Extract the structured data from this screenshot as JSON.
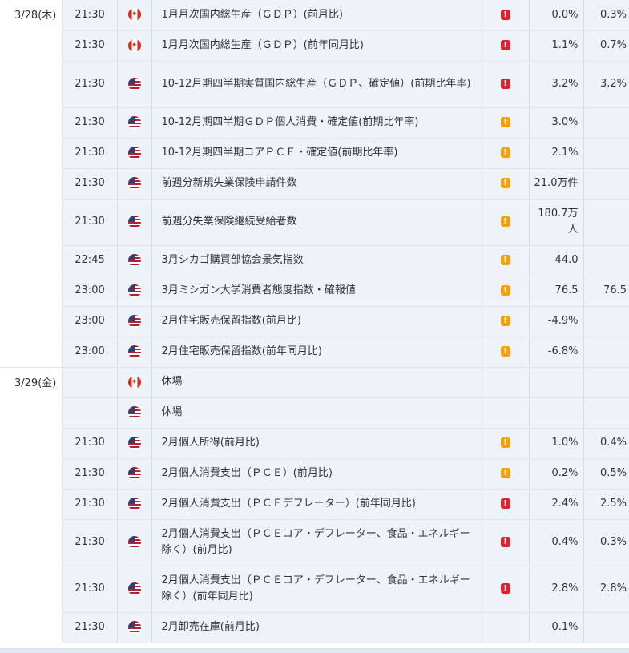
{
  "colors": {
    "high": "#d9232f",
    "mid": "#f5a00f",
    "row_bg": "#eef3fa"
  },
  "days": [
    {
      "date": "3/28(木)",
      "rows": [
        {
          "time": "21:30",
          "country": "ca",
          "flag_icon": "canada-flag-icon",
          "event": "1月月次国内総生産（ＧＤＰ）(前月比)",
          "importance": "high",
          "mark": "!",
          "previous": "0.0%",
          "forecast": "0.3%"
        },
        {
          "time": "21:30",
          "country": "ca",
          "flag_icon": "canada-flag-icon",
          "event": "1月月次国内総生産（ＧＤＰ）(前年同月比)",
          "importance": "high",
          "mark": "!",
          "previous": "1.1%",
          "forecast": "0.7%"
        },
        {
          "time": "21:30",
          "country": "us",
          "flag_icon": "us-flag-icon",
          "event": "10-12月期四半期実質国内総生産（ＧＤＰ、確定値）(前期比年率)",
          "importance": "high",
          "mark": "!",
          "previous": "3.2%",
          "forecast": "3.2%",
          "tall": true
        },
        {
          "time": "21:30",
          "country": "us",
          "flag_icon": "us-flag-icon",
          "event": "10-12月期四半期ＧＤＰ個人消費・確定値(前期比年率)",
          "importance": "mid",
          "mark": "!",
          "previous": "3.0%",
          "forecast": ""
        },
        {
          "time": "21:30",
          "country": "us",
          "flag_icon": "us-flag-icon",
          "event": "10-12月期四半期コアＰＣＥ・確定値(前期比年率)",
          "importance": "mid",
          "mark": "!",
          "previous": "2.1%",
          "forecast": ""
        },
        {
          "time": "21:30",
          "country": "us",
          "flag_icon": "us-flag-icon",
          "event": "前週分新規失業保険申請件数",
          "importance": "mid",
          "mark": "!",
          "previous": "21.0万件",
          "forecast": ""
        },
        {
          "time": "21:30",
          "country": "us",
          "flag_icon": "us-flag-icon",
          "event": "前週分失業保険継続受給者数",
          "importance": "mid",
          "mark": "!",
          "previous": "180.7万人",
          "forecast": "",
          "tall": true
        },
        {
          "time": "22:45",
          "country": "us",
          "flag_icon": "us-flag-icon",
          "event": "3月シカゴ購買部協会景気指数",
          "importance": "mid",
          "mark": "!",
          "previous": "44.0",
          "forecast": ""
        },
        {
          "time": "23:00",
          "country": "us",
          "flag_icon": "us-flag-icon",
          "event": "3月ミシガン大学消費者態度指数・確報値",
          "importance": "mid",
          "mark": "!",
          "previous": "76.5",
          "forecast": "76.5"
        },
        {
          "time": "23:00",
          "country": "us",
          "flag_icon": "us-flag-icon",
          "event": "2月住宅販売保留指数(前月比)",
          "importance": "mid",
          "mark": "!",
          "previous": "-4.9%",
          "forecast": ""
        },
        {
          "time": "23:00",
          "country": "us",
          "flag_icon": "us-flag-icon",
          "event": "2月住宅販売保留指数(前年同月比)",
          "importance": "mid",
          "mark": "!",
          "previous": "-6.8%",
          "forecast": ""
        }
      ]
    },
    {
      "date": "3/29(金)",
      "rows": [
        {
          "time": "",
          "country": "ca",
          "flag_icon": "canada-flag-icon",
          "event": "休場",
          "importance": "",
          "mark": "",
          "previous": "",
          "forecast": ""
        },
        {
          "time": "",
          "country": "us",
          "flag_icon": "us-flag-icon",
          "event": "休場",
          "importance": "",
          "mark": "",
          "previous": "",
          "forecast": ""
        },
        {
          "time": "21:30",
          "country": "us",
          "flag_icon": "us-flag-icon",
          "event": "2月個人所得(前月比)",
          "importance": "mid",
          "mark": "!",
          "previous": "1.0%",
          "forecast": "0.4%"
        },
        {
          "time": "21:30",
          "country": "us",
          "flag_icon": "us-flag-icon",
          "event": "2月個人消費支出（ＰＣＥ）(前月比)",
          "importance": "mid",
          "mark": "!",
          "previous": "0.2%",
          "forecast": "0.5%"
        },
        {
          "time": "21:30",
          "country": "us",
          "flag_icon": "us-flag-icon",
          "event": "2月個人消費支出（ＰＣＥデフレーター）(前年同月比)",
          "importance": "high",
          "mark": "!",
          "previous": "2.4%",
          "forecast": "2.5%"
        },
        {
          "time": "21:30",
          "country": "us",
          "flag_icon": "us-flag-icon",
          "event": "2月個人消費支出（ＰＣＥコア・デフレーター、食品・エネルギー除く）(前月比)",
          "importance": "high",
          "mark": "!",
          "previous": "0.4%",
          "forecast": "0.3%",
          "tall": true
        },
        {
          "time": "21:30",
          "country": "us",
          "flag_icon": "us-flag-icon",
          "event": "2月個人消費支出（ＰＣＥコア・デフレーター、食品・エネルギー除く）(前年同月比)",
          "importance": "high",
          "mark": "!",
          "previous": "2.8%",
          "forecast": "2.8%",
          "tall": true
        },
        {
          "time": "21:30",
          "country": "us",
          "flag_icon": "us-flag-icon",
          "event": "2月卸売在庫(前月比)",
          "importance": "",
          "mark": "",
          "previous": "-0.1%",
          "forecast": ""
        }
      ]
    }
  ]
}
